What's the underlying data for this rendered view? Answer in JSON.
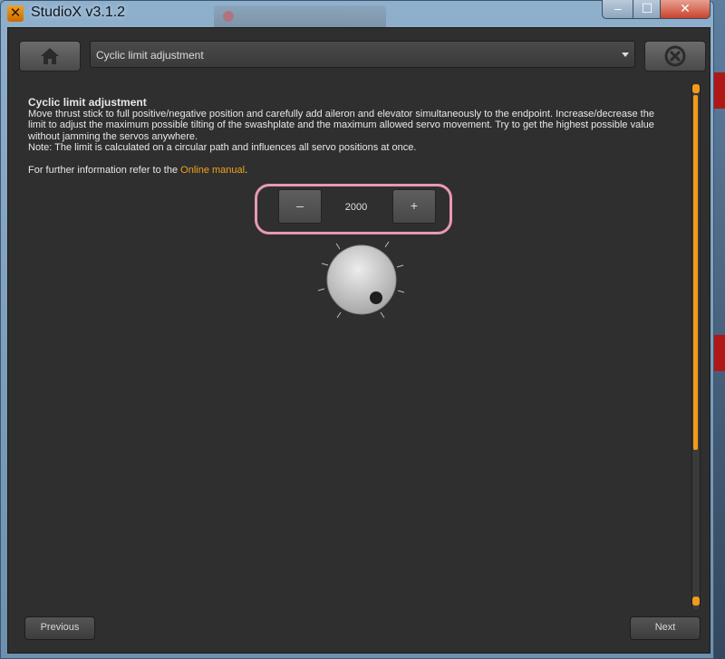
{
  "window": {
    "title": "StudioX v3.1.2",
    "controls": {
      "minimize": "–",
      "maximize": "☐",
      "close": "✕"
    }
  },
  "toolbar": {
    "home_icon": "home-icon",
    "step_select": {
      "selected": "Cyclic limit adjustment"
    },
    "cancel_icon": "cancel-circle-icon"
  },
  "content": {
    "heading": "Cyclic limit adjustment",
    "description": "Move thrust stick to full positive/negative position and carefully add aileron and elevator simultaneously to the endpoint. Increase/decrease the\nlimit to adjust the maximum possible tilting of the swashplate and the maximum allowed servo movement. Try to get the highest possible value\nwithout jamming the servos anywhere.",
    "note": "Note: The limit is calculated on a circular path and influences all servo positions at once.",
    "info_prefix": "For further information refer to the ",
    "info_link": "Online manual",
    "info_suffix": "."
  },
  "stepper": {
    "minus_label": "–",
    "plus_label": "+",
    "value": "2000"
  },
  "knob": {
    "icon": "rotary-knob-icon"
  },
  "footer": {
    "previous_label": "Previous",
    "next_label": "Next"
  },
  "colors": {
    "accent": "#f29a1c",
    "highlight_ring": "#e79ab0",
    "background": "#2f2f2f"
  }
}
